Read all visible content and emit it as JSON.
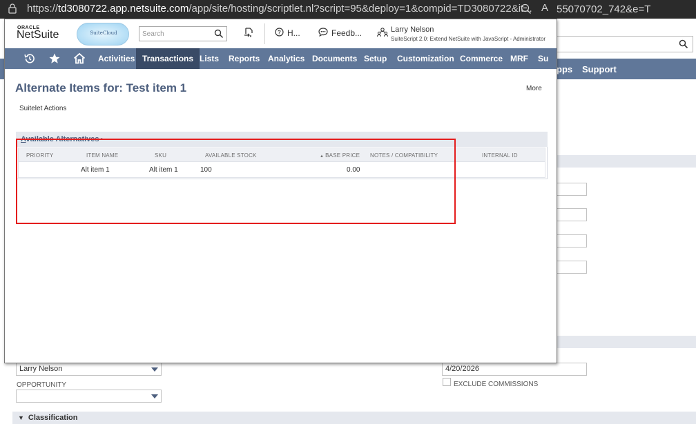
{
  "browser": {
    "url_prefix": "https://",
    "url_host": "td3080722.app.netsuite.com",
    "url_path": "/app/site/hosting/scriptlet.nl?script=95&deploy=1&compid=TD3080722&it...",
    "zoom_icon": "zoom-out-icon",
    "reader_label": "A",
    "background_url_tail": "55070702_742&e=T"
  },
  "header": {
    "logo_oracle": "ORACLE",
    "logo_netsuite": "NetSuite",
    "logo_cloud": "SuiteCloud",
    "search_placeholder": "Search",
    "help_label": "H...",
    "feedback_label": "Feedb...",
    "user_name": "Larry Nelson",
    "user_role": "SuiteScript 2.0: Extend NetSuite with JavaScript - Administrator"
  },
  "nav": {
    "items": [
      {
        "label": "Activities"
      },
      {
        "label": "Transactions"
      },
      {
        "label": "Lists"
      },
      {
        "label": "Reports"
      },
      {
        "label": "Analytics"
      },
      {
        "label": "Documents"
      },
      {
        "label": "Setup"
      },
      {
        "label": "Customization"
      },
      {
        "label": "Commerce"
      },
      {
        "label": "MRF"
      },
      {
        "label": "Su"
      }
    ],
    "active": "Transactions",
    "background_items": [
      "pps",
      "Support"
    ]
  },
  "page": {
    "title": "Alternate Items for: Test item 1",
    "more_label": "More",
    "suitelet_actions": "Suitelet Actions"
  },
  "sublist": {
    "tab_label_first": "A",
    "tab_label_rest": "vailable Alternatives",
    "tab_dot": "•",
    "columns": [
      "PRIORITY",
      "ITEM NAME",
      "SKU",
      "AVAILABLE STOCK",
      "BASE PRICE",
      "NOTES / COMPATIBILITY",
      "INTERNAL ID"
    ],
    "rows": [
      {
        "priority": "",
        "item_name": "Alt item 1",
        "sku": "Alt item 1",
        "available_stock": "100",
        "base_price": "0.00",
        "notes": "",
        "internal_id": ""
      }
    ]
  },
  "background_form": {
    "sales_rep_value": "Larry Nelson",
    "opportunity_label": "OPPORTUNITY",
    "opportunity_value": "",
    "date_value": "4/20/2026",
    "exclude_commissions_label": "EXCLUDE COMMISSIONS",
    "classification_label": "Classification"
  },
  "colors": {
    "nav_bg": "#607799",
    "nav_active": "#394a66",
    "title": "#4d5f7e",
    "highlight_box": "#e41d1d"
  }
}
